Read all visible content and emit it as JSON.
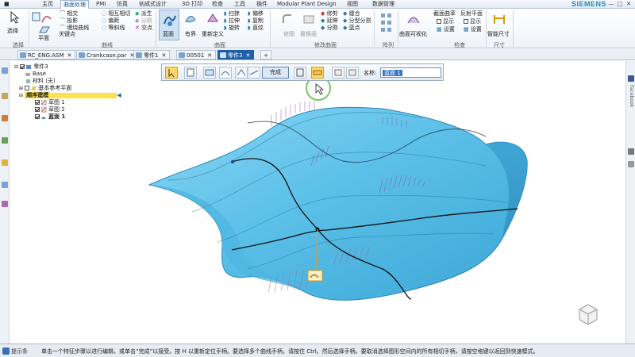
{
  "menu": {
    "tabs": [
      "主页",
      "曲面处理",
      "PMI",
      "仿真",
      "创成式设计",
      "3D 打印",
      "检查",
      "工具",
      "插件",
      "Modular Plant Design",
      "视图",
      "数据管理"
    ],
    "active_index": 1,
    "brand": "SIEMENS",
    "window_buttons": [
      "?",
      "—",
      "□",
      "✕"
    ]
  },
  "ribbon": {
    "select": {
      "label": "选择",
      "group": "选择"
    },
    "sketch": {
      "row1": "相交",
      "row2": "投影",
      "row3": "缠绕曲线",
      "row4": "相互相切",
      "row5": "偏距",
      "row6": "等斜线",
      "row7": "派生",
      "row8": "分割",
      "row9": "交点",
      "key_label": "关键点",
      "group": "曲线"
    },
    "plane": {
      "label": "平面"
    },
    "surface": {
      "blue": "蓝面",
      "bounded": "有界",
      "redefine": "重新定义",
      "row1": "扫掠",
      "row2": "拉伸",
      "row3": "旋转",
      "row4": "偏移",
      "row5": "复制",
      "row6": "直纹",
      "group": "曲面"
    },
    "modify": {
      "rounded": "修圆",
      "replace": "替换面",
      "row1": "修剪",
      "row2": "延伸",
      "row3": "分割",
      "row4": "缝合",
      "row5": "分型分割",
      "row6": "蓝点",
      "group": "修改曲面"
    },
    "array": {
      "group": "阵列"
    },
    "inspect": {
      "viz": "曲面可视化",
      "curvature": "截面曲率",
      "show1": "显示",
      "settings1": "设置",
      "reflect": "反射平面",
      "show2": "显示",
      "settings2": "设置",
      "group": "检查"
    },
    "dim": {
      "smart": "智能尺寸",
      "group": "尺寸"
    }
  },
  "doc_tabs": [
    {
      "label": "RC_ENG.ASM",
      "active": false
    },
    {
      "label": "Crankcase.par",
      "active": false
    },
    {
      "label": "零件1",
      "active": false
    },
    {
      "label": "00501",
      "active": false
    },
    {
      "label": "零件3",
      "active": true
    }
  ],
  "tree": {
    "root": "零件3",
    "base": "Base",
    "material": "材料 (无)",
    "ref_planes": "基本参考平面",
    "order_group": "顺序建模",
    "sketch1": "草图 1",
    "sketch2": "草图 2",
    "blue_surface": "蓝面 1"
  },
  "command_bar": {
    "done_label": "完成",
    "name_label": "名称:",
    "name_value": "蓝面 1"
  },
  "status": {
    "label": "提示条",
    "message": "单击一个特征步骤以进行编辑，或单击“完成”以接受。按 H 以重新定位手柄。要选择多个曲线手柄，请按住 Ctrl。然后选择手柄。要取消选择图形空间内的所有相切手柄，请按空格键以返回到快速模式。"
  },
  "right_panel": {
    "label": "Facebook"
  },
  "colors": {
    "surface": "#62c4ea",
    "surface_dark": "#2f9ccb",
    "accent": "#1e5fa8",
    "highlight": "#ffe14d",
    "comb": "#8a5aa8",
    "cursor_ring": "#5bbf4a"
  }
}
